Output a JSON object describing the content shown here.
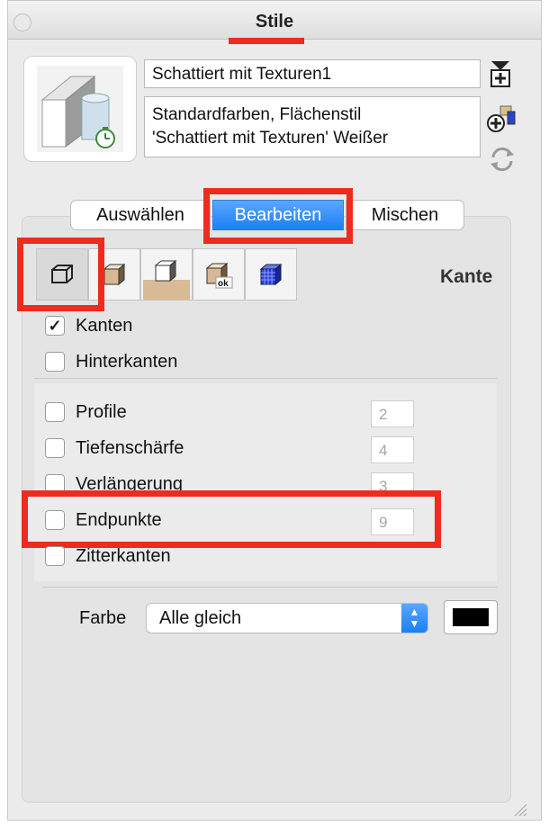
{
  "window": {
    "title": "Stile"
  },
  "style": {
    "name": "Schattiert mit Texturen1",
    "description": "Standardfarben, Flächenstil\n'Schattiert mit Texturen' Weißer"
  },
  "side_icons": [
    "add-to-model-icon",
    "create-style-icon",
    "update-style-icon"
  ],
  "tabs": [
    {
      "label": "Auswählen",
      "active": false
    },
    {
      "label": "Bearbeiten",
      "active": true
    },
    {
      "label": "Mischen",
      "active": false
    }
  ],
  "categories": [
    "edge-settings-icon",
    "face-settings-icon",
    "background-settings-icon",
    "watermark-settings-icon",
    "modeling-settings-icon"
  ],
  "section_title": "Kante",
  "edges": {
    "kanten": {
      "label": "Kanten",
      "checked": true
    },
    "hinterkanten": {
      "label": "Hinterkanten",
      "checked": false
    }
  },
  "edge_options": [
    {
      "label": "Profile",
      "checked": false,
      "value": "2"
    },
    {
      "label": "Tiefenschärfe",
      "checked": false,
      "value": "4"
    },
    {
      "label": "Verlängerung",
      "checked": false,
      "value": "3"
    },
    {
      "label": "Endpunkte",
      "checked": false,
      "value": "9"
    },
    {
      "label": "Zitterkanten",
      "checked": false
    }
  ],
  "color": {
    "label": "Farbe",
    "selected": "Alle gleich",
    "swatch": "#000000"
  },
  "accent": "#1c7ff3",
  "highlight": "#ee2b1f"
}
